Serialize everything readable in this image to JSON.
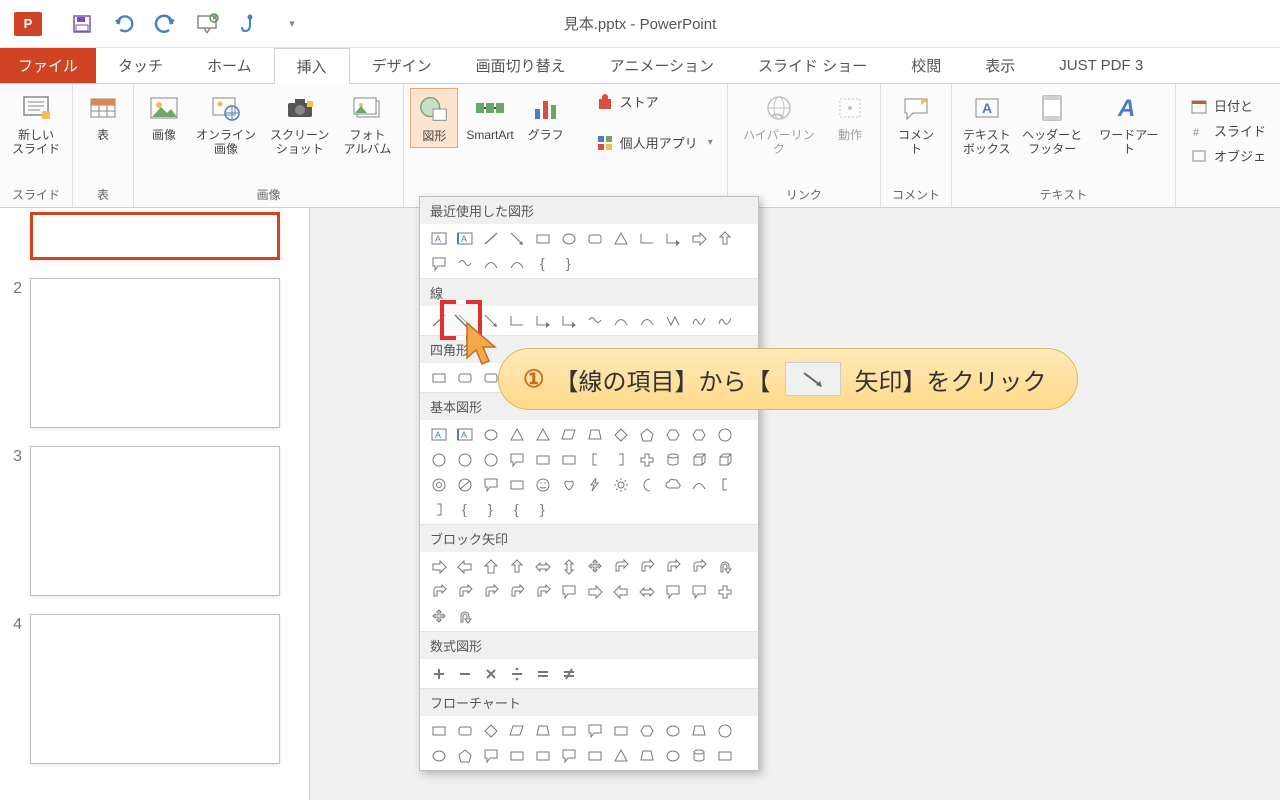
{
  "app": {
    "title": "見本.pptx - PowerPoint",
    "icon_label": "P"
  },
  "tabs": {
    "file": "ファイル",
    "list": [
      "タッチ",
      "ホーム",
      "挿入",
      "デザイン",
      "画面切り替え",
      "アニメーション",
      "スライド ショー",
      "校閲",
      "表示",
      "JUST PDF 3"
    ],
    "active_index": 2
  },
  "ribbon": {
    "groups": {
      "slides": {
        "label": "スライド",
        "new_slide": "新しい\nスライド"
      },
      "tables": {
        "label": "表",
        "table": "表"
      },
      "images": {
        "label": "画像",
        "picture": "画像",
        "online": "オンライン\n画像",
        "screenshot": "スクリーン\nショット",
        "album": "フォト\nアルバム"
      },
      "illustrations": {
        "shapes": "図形",
        "smartart": "SmartArt",
        "chart": "グラフ"
      },
      "apps": {
        "store": "ストア",
        "myapps": "個人用アプリ"
      },
      "links": {
        "label": "リンク",
        "hyperlink": "ハイパーリンク",
        "action": "動作"
      },
      "comments": {
        "label": "コメント",
        "comment": "コメント"
      },
      "text": {
        "label": "テキスト",
        "textbox": "テキスト\nボックス",
        "headerfooter": "ヘッダーと\nフッター",
        "wordart": "ワードアート"
      },
      "right": {
        "date": "日付と",
        "slide": "スライド",
        "object": "オブジェ"
      }
    }
  },
  "shapes_menu": {
    "recent": "最近使用した図形",
    "lines": "線",
    "rects": "四角形",
    "basic": "基本図形",
    "block_arrows": "ブロック矢印",
    "equation": "数式図形",
    "flowchart": "フローチャート"
  },
  "thumbs": {
    "nums": [
      "2",
      "3",
      "4"
    ]
  },
  "callout": {
    "num": "①",
    "t1": "【線の項目】から【",
    "t2": "矢印】をクリック"
  }
}
